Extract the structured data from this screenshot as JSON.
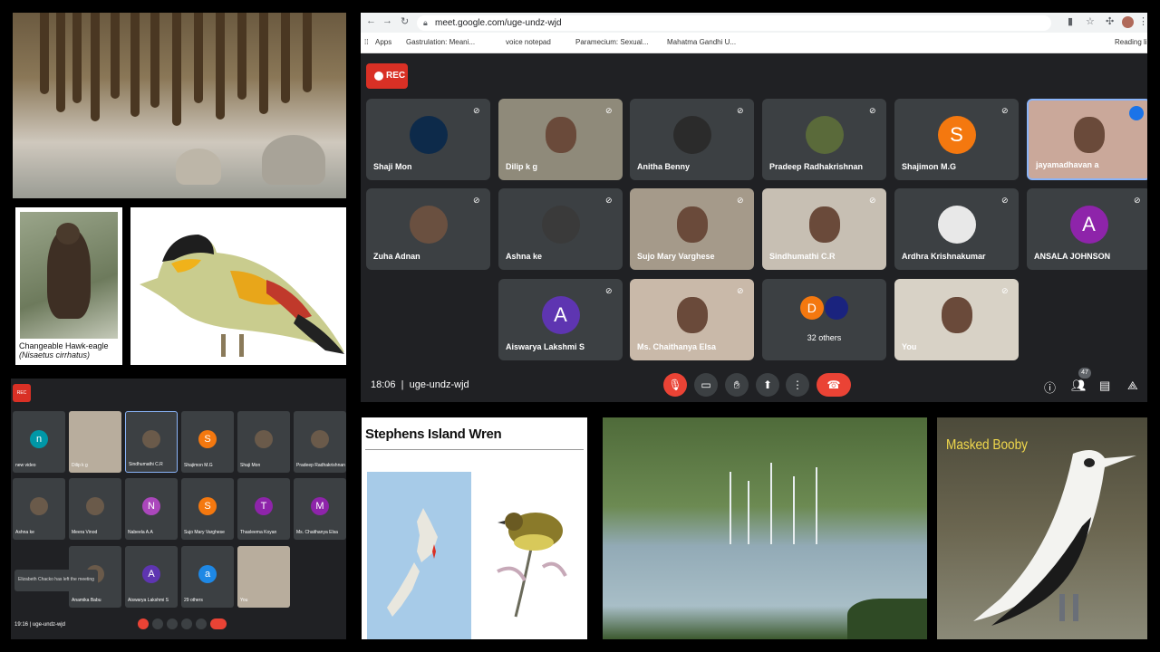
{
  "browser": {
    "url": "meet.google.com/uge-undz-wjd",
    "bookmarks": [
      "Apps",
      "Gastrulation: Meani...",
      "voice notepad",
      "Paramecium: Sexual...",
      "Mahatma Gandhi U...",
      "Reading li"
    ]
  },
  "meeting": {
    "rec_label": "REC",
    "time": "18:06",
    "code": "uge-undz-wjd",
    "participant_count": "47",
    "participants": [
      {
        "name": "Shaji Mon",
        "initial": "",
        "color": ""
      },
      {
        "name": "Dilip k g",
        "initial": "",
        "color": ""
      },
      {
        "name": "Anitha Benny",
        "initial": "",
        "color": ""
      },
      {
        "name": "Pradeep Radhakrishnan",
        "initial": "",
        "color": ""
      },
      {
        "name": "Shajimon M.G",
        "initial": "S",
        "color": "#f4780f"
      },
      {
        "name": "jayamadhavan a",
        "initial": "",
        "color": ""
      },
      {
        "name": "Zuha Adnan",
        "initial": "",
        "color": ""
      },
      {
        "name": "Ashna ke",
        "initial": "",
        "color": ""
      },
      {
        "name": "Sujo Mary Varghese",
        "initial": "",
        "color": ""
      },
      {
        "name": "Sindhumathi C.R",
        "initial": "",
        "color": ""
      },
      {
        "name": "Ardhra Krishnakumar",
        "initial": "",
        "color": ""
      },
      {
        "name": "ANSALA JOHNSON",
        "initial": "A",
        "color": "#8e24aa"
      },
      {
        "name": "Aiswarya Lakshmi S",
        "initial": "A",
        "color": "#5e35b1"
      },
      {
        "name": "Ms. Chaithanya Elsa",
        "initial": "",
        "color": ""
      },
      {
        "name": "32 others",
        "initial": "D",
        "color": "#f4780f"
      },
      {
        "name": "You",
        "initial": "",
        "color": ""
      }
    ]
  },
  "small_meeting": {
    "rec_label": "REC",
    "time": "19:16",
    "code": "uge-undz-wjd",
    "toast": "Elizabeth Chacko has left the meeting",
    "participants": [
      {
        "name": "new video",
        "initial": "n",
        "color": "#0097a7"
      },
      {
        "name": "Dilip k g",
        "initial": "",
        "color": ""
      },
      {
        "name": "Sindhumathi C.R",
        "initial": "",
        "color": ""
      },
      {
        "name": "Shajimon M.G",
        "initial": "S",
        "color": "#f4780f"
      },
      {
        "name": "Shaji Mon",
        "initial": "",
        "color": ""
      },
      {
        "name": "Pradeep Radhakrishnan",
        "initial": "",
        "color": ""
      },
      {
        "name": "Ashna ke",
        "initial": "",
        "color": ""
      },
      {
        "name": "Meera Vinod",
        "initial": "",
        "color": ""
      },
      {
        "name": "Nabeela A.A",
        "initial": "N",
        "color": "#ab47bc"
      },
      {
        "name": "Sujo Mary Varghese",
        "initial": "S",
        "color": "#f4780f"
      },
      {
        "name": "Thasleema Koyan",
        "initial": "T",
        "color": "#8e24aa"
      },
      {
        "name": "Ms. Chaithanya Elsa",
        "initial": "M",
        "color": "#8e24aa"
      },
      {
        "name": "",
        "initial": "",
        "color": ""
      },
      {
        "name": "Anamika Babu",
        "initial": "",
        "color": ""
      },
      {
        "name": "Aiswarya Lakshmi S",
        "initial": "A",
        "color": "#5e35b1"
      },
      {
        "name": "29 others",
        "initial": "a",
        "color": "#1e88e5"
      },
      {
        "name": "You",
        "initial": "",
        "color": ""
      }
    ]
  },
  "hawk_caption": {
    "line1": "Changeable Hawk-eagle",
    "line2": "(Nisaetus cirrhatus)"
  },
  "wren_title": "Stephens Island Wren",
  "booby_title": "Masked Booby"
}
